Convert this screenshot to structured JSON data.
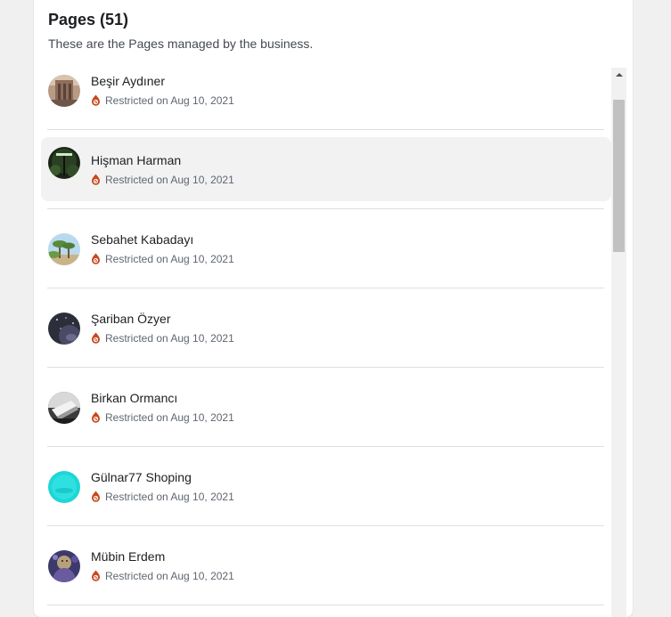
{
  "header": {
    "title": "Pages (51)",
    "subtitle": "These are the Pages managed by the business."
  },
  "status_icon": "restricted-icon",
  "status_color": "#c8481c",
  "pages": [
    {
      "name": "Beşir Aydıner",
      "status": "Restricted on Aug 10, 2021",
      "avatar": "building-photo"
    },
    {
      "name": "Hişman Harman",
      "status": "Restricted on Aug 10, 2021",
      "avatar": "night-light-photo"
    },
    {
      "name": "Sebahet Kabadayı",
      "status": "Restricted on Aug 10, 2021",
      "avatar": "palm-trees-photo"
    },
    {
      "name": "Şariban Özyer",
      "status": "Restricted on Aug 10, 2021",
      "avatar": "night-sky-photo"
    },
    {
      "name": "Birkan Ormancı",
      "status": "Restricted on Aug 10, 2021",
      "avatar": "laptop-photo"
    },
    {
      "name": "Gülnar77 Shoping",
      "status": "Restricted on Aug 10, 2021",
      "avatar": "cyan-circle"
    },
    {
      "name": "Mübin Erdem",
      "status": "Restricted on Aug 10, 2021",
      "avatar": "portrait-photo"
    }
  ]
}
